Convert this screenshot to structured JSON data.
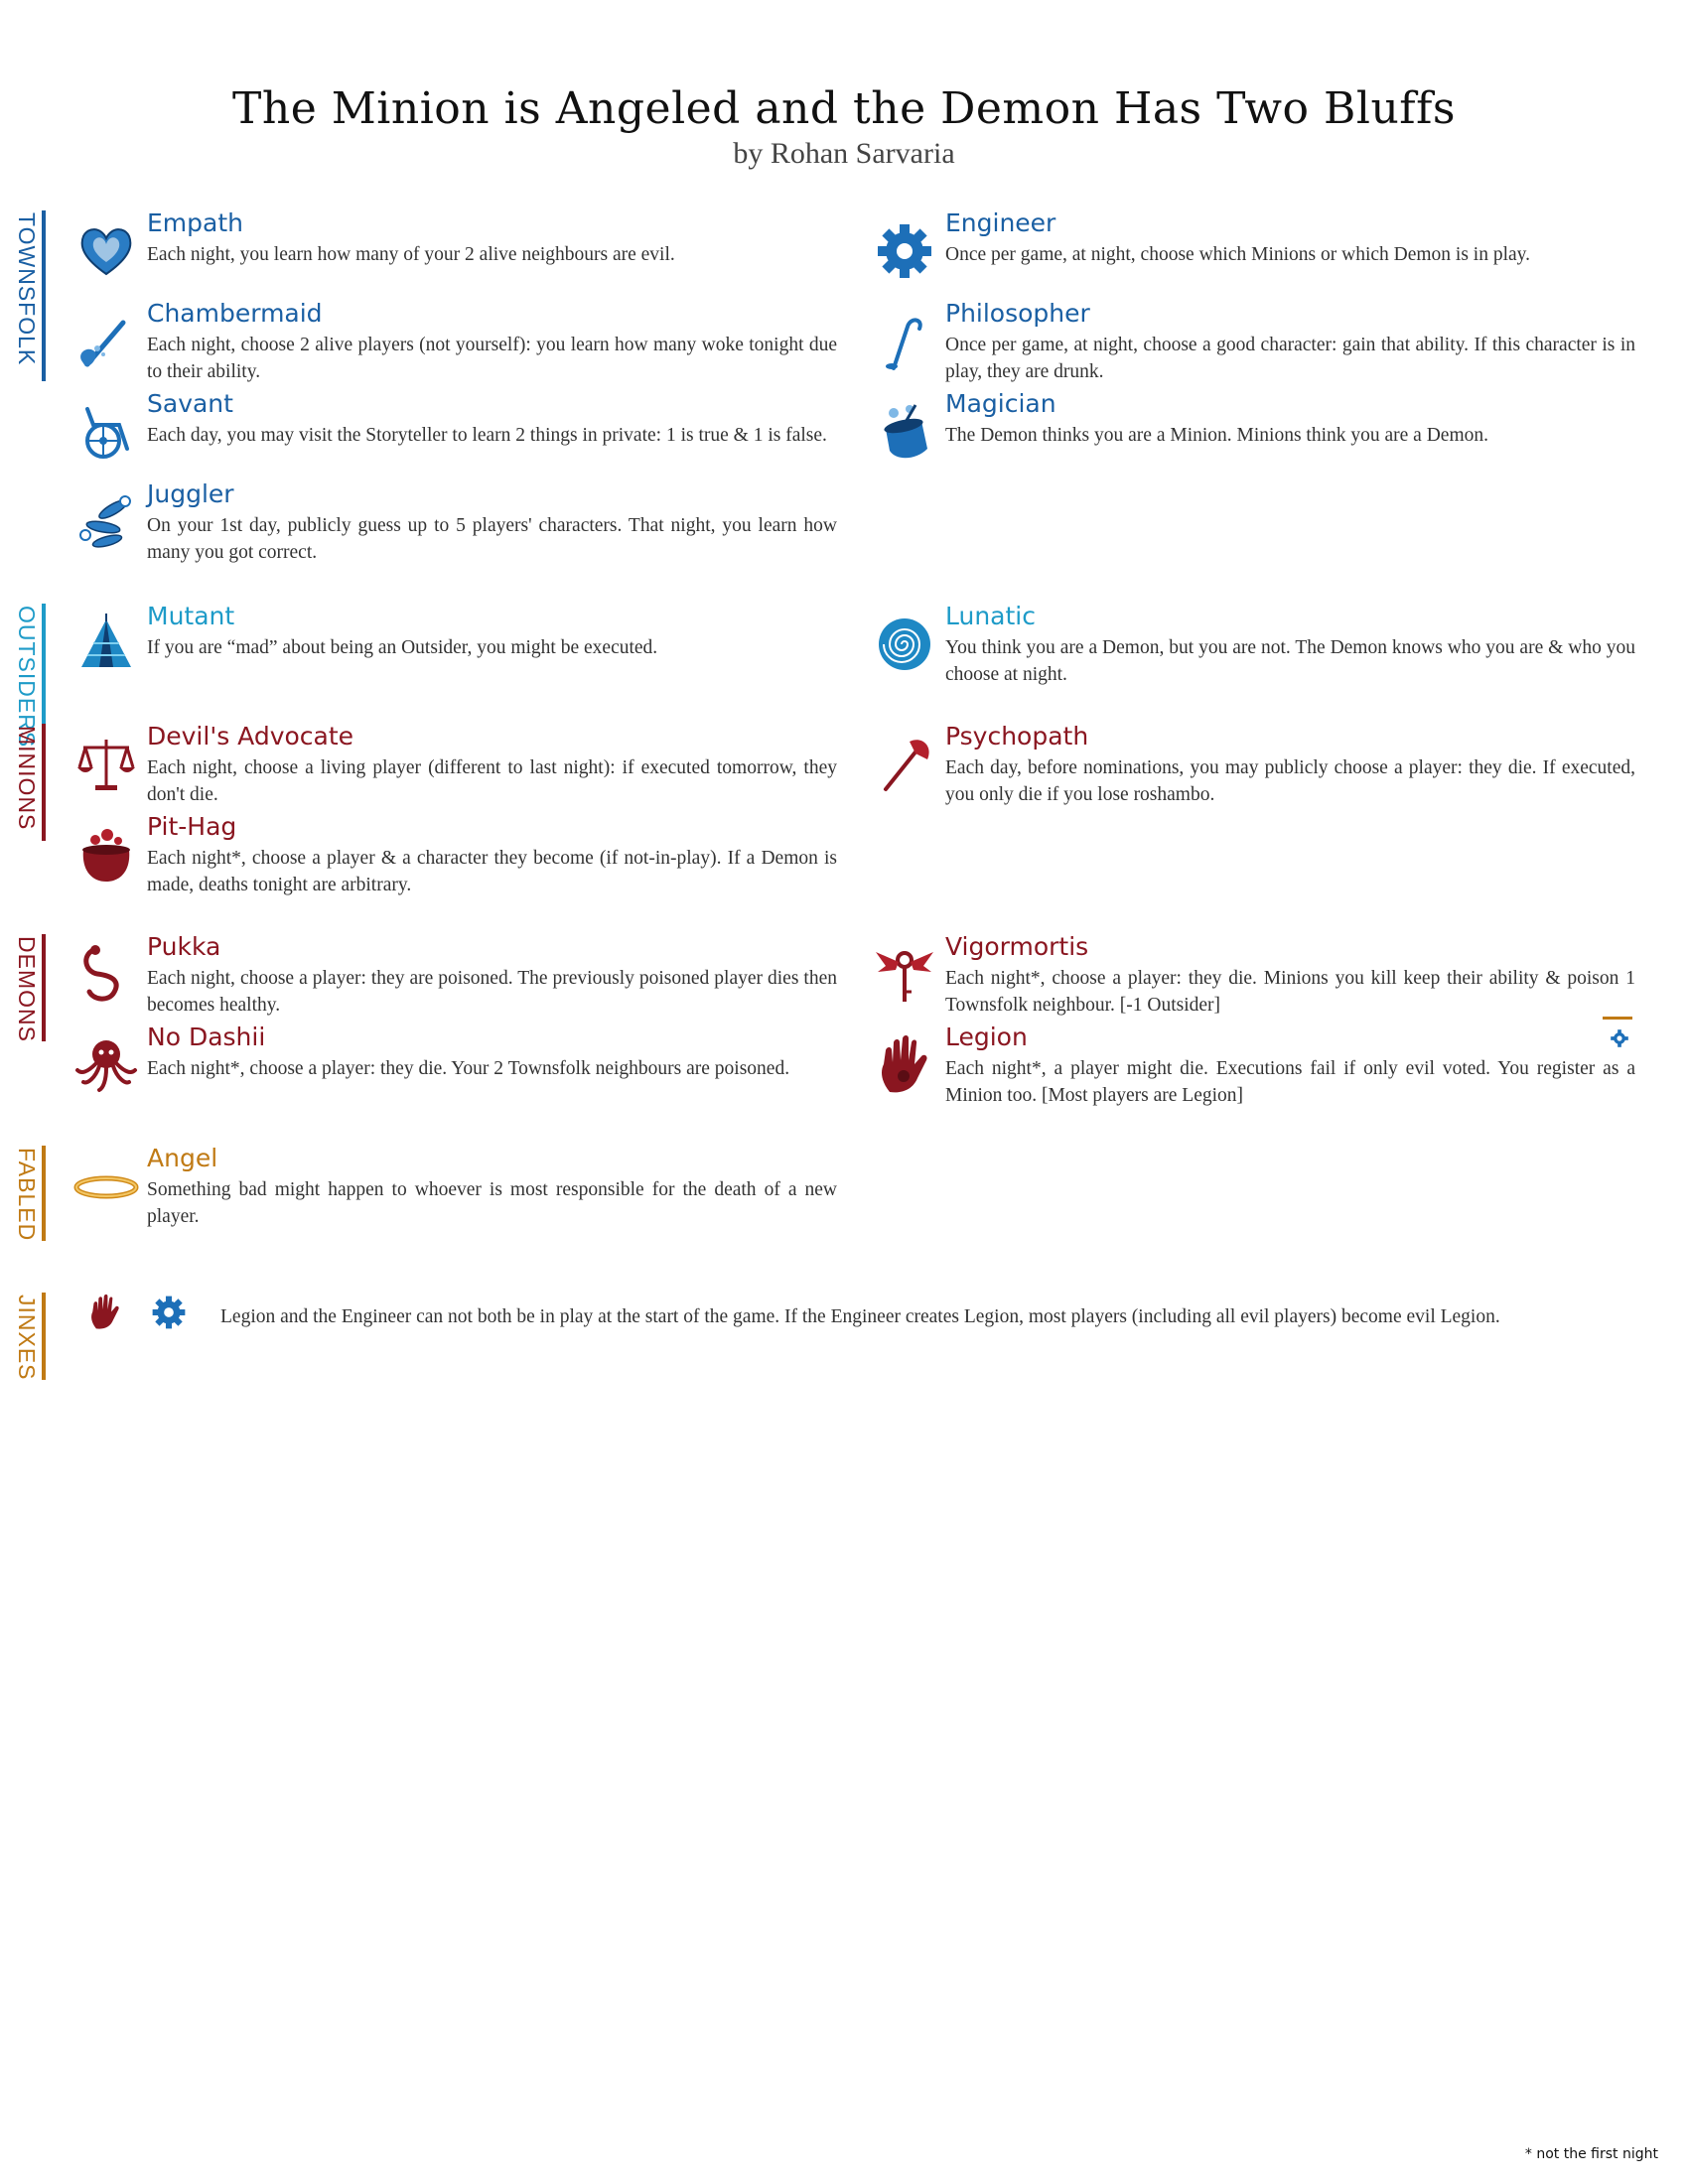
{
  "header": {
    "title": "The Minion is Angeled and the Demon Has Two Bluffs",
    "author": "by Rohan Sarvaria"
  },
  "colors": {
    "townsfolk": "#1a5fa3",
    "outsider": "#1e9bc8",
    "minion": "#8a1620",
    "demon": "#8a1620",
    "fabled": "#c07a14"
  },
  "sections": {
    "townsfolk": {
      "label": "TOWNSFOLK",
      "chars": [
        {
          "name": "Empath",
          "icon": "heart-icon",
          "ability": "Each night, you learn how many of your 2 alive neighbours are evil."
        },
        {
          "name": "Engineer",
          "icon": "gear-icon",
          "ability": "Once per game, at night, choose which Minions or which Demon is in play."
        },
        {
          "name": "Chambermaid",
          "icon": "feather-duster-icon",
          "ability": "Each night, choose 2 alive players (not yourself): you learn how many woke tonight due to their ability."
        },
        {
          "name": "Philosopher",
          "icon": "cane-icon",
          "ability": "Once per game, at night, choose a good character: gain that ability. If this character is in play, they are drunk."
        },
        {
          "name": "Savant",
          "icon": "wheelchair-icon",
          "ability": "Each day, you may visit the Storyteller to learn 2 things in private: 1 is true & 1 is false."
        },
        {
          "name": "Magician",
          "icon": "magic-hat-icon",
          "ability": "The Demon thinks you are a Minion. Minions think you are a Demon."
        },
        {
          "name": "Juggler",
          "icon": "juggling-pins-icon",
          "ability": "On your 1st day, publicly guess up to 5 players' characters. That night, you learn how many you got correct."
        }
      ]
    },
    "outsiders": {
      "label": "OUTSIDERS",
      "chars": [
        {
          "name": "Mutant",
          "icon": "tent-icon",
          "ability": "If you are “mad” about being an Outsider, you might be executed."
        },
        {
          "name": "Lunatic",
          "icon": "spiral-icon",
          "ability": "You think you are a Demon, but you are not. The Demon knows who you are & who you choose at night."
        }
      ]
    },
    "minions": {
      "label": "MINIONS",
      "chars": [
        {
          "name": "Devil's Advocate",
          "icon": "scales-icon",
          "ability": "Each night, choose a living player (different to last night): if executed tomorrow, they don't die."
        },
        {
          "name": "Psychopath",
          "icon": "axe-icon",
          "ability": "Each day, before nominations, you may publicly choose a player: they die. If executed, you only die if you lose roshambo."
        },
        {
          "name": "Pit-Hag",
          "icon": "cauldron-icon",
          "ability": "Each night*, choose a player & a character they become (if not-in-play). If a Demon is made, deaths tonight are arbitrary."
        }
      ]
    },
    "demons": {
      "label": "DEMONS",
      "chars": [
        {
          "name": "Pukka",
          "icon": "snake-icon",
          "ability": "Each night, choose a player: they are poisoned. The previously poisoned player dies then becomes healthy."
        },
        {
          "name": "Vigormortis",
          "icon": "winged-key-icon",
          "ability": "Each night*, choose a player: they die. Minions you kill keep their ability & poison 1 Townsfolk neighbour. [-1 Outsider]"
        },
        {
          "name": "No Dashii",
          "icon": "octopus-icon",
          "ability": "Each night*, choose a player: they die. Your 2 Townsfolk neighbours are poisoned."
        },
        {
          "name": "Legion",
          "icon": "hand-icon",
          "ability": "Each night*, a player might die. Executions fail if only evil voted. You register as a Minion too. [Most players are Legion]"
        }
      ]
    },
    "fabled": {
      "label": "FABLED",
      "chars": [
        {
          "name": "Angel",
          "icon": "halo-icon",
          "ability": "Something bad might happen to whoever is most responsible for the death of a new player."
        }
      ]
    },
    "jinxes": {
      "label": "JINXES",
      "text": "Legion and the Engineer can not both be in play at the start of the game. If the Engineer creates Legion, most players (including all evil players) become evil Legion."
    }
  },
  "footnote": "* not the first night"
}
